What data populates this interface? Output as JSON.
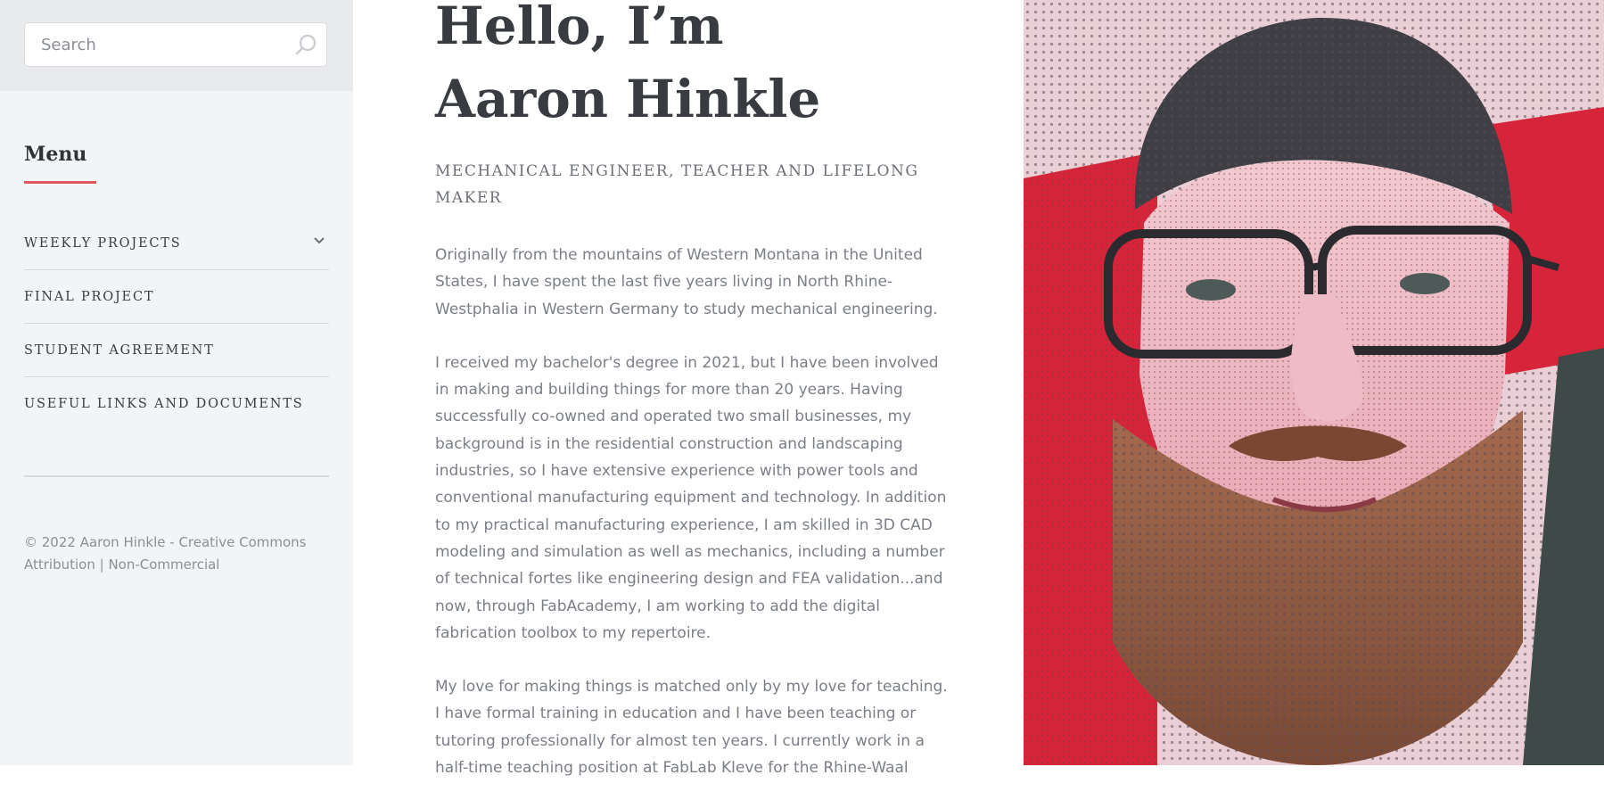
{
  "search": {
    "placeholder": "Search"
  },
  "sidebar": {
    "menu_title": "Menu",
    "items": [
      {
        "label": "WEEKLY PROJECTS",
        "has_children": true
      },
      {
        "label": "FINAL PROJECT"
      },
      {
        "label": "STUDENT AGREEMENT"
      },
      {
        "label": "USEFUL LINKS AND DOCUMENTS"
      }
    ],
    "footer": "© 2022 Aaron Hinkle - Creative Commons Attribution | Non-Commercial"
  },
  "main": {
    "title": "Hello, I’m\nAaron Hinkle",
    "subtitle": "MECHANICAL ENGINEER, TEACHER AND LIFELONG MAKER",
    "paragraphs": [
      "Originally from the mountains of Western Montana in the United States, I have spent the last five years living in North Rhine-Westphalia in Western Germany to study mechanical engineering.",
      "I received my bachelor's degree in 2021, but I have been involved in making and building things for more than 20 years. Having successfully co-owned and operated two small businesses, my background is in the residential construction and landscaping industries, so I have extensive experience with power tools and conventional manufacturing equipment and technology. In addition to my practical manufacturing experience, I am skilled in 3D CAD modeling and simulation as well as mechanics, including a number of technical fortes like engineering design and FEA validation...and now, through FabAcademy, I am working to add the digital fabrication toolbox to my repertoire.",
      "My love for making things is matched only by my love for teaching. I have formal training in education and I have been teaching or tutoring professionally for almost ten years. I currently work in a half-time teaching position at FabLab Kleve for the Rhine-Waal"
    ]
  },
  "colors": {
    "accent": "#e0575b",
    "sidebar_bg": "#f3f4f6",
    "search_band": "#e9eaec",
    "heading": "#383c41",
    "body_text": "#7b7f86"
  },
  "icons": {
    "search": "search-icon",
    "submenu": "chevron-down-icon"
  }
}
